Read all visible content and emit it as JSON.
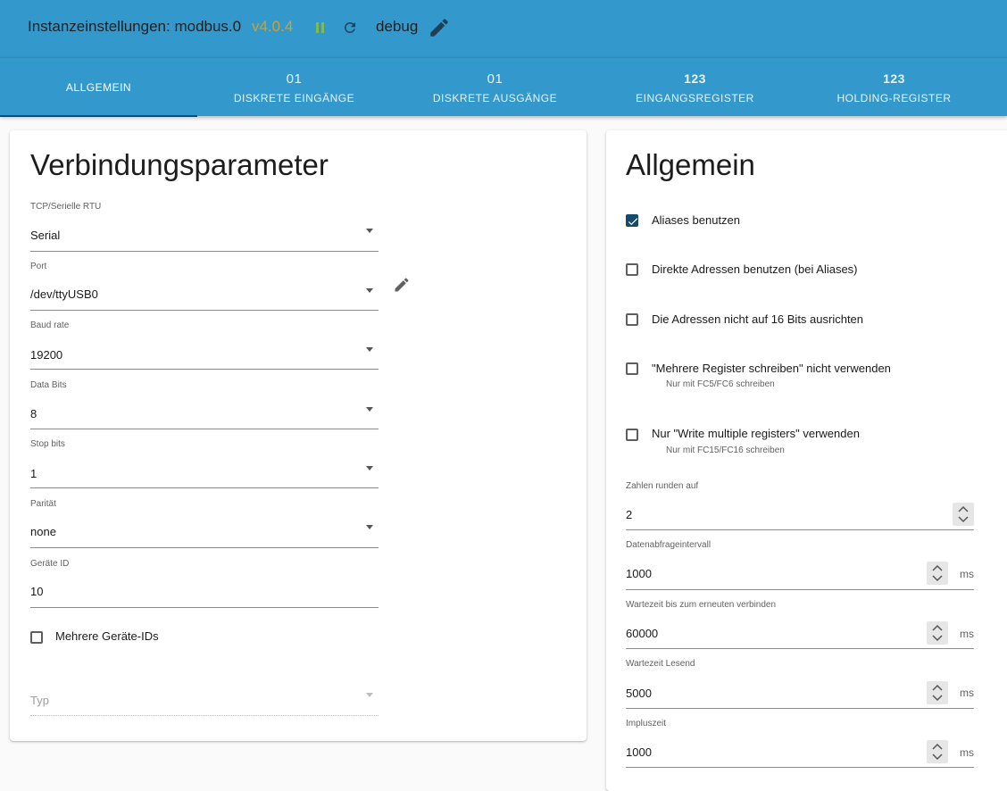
{
  "header": {
    "title": "Instanzeinstellungen: modbus.0",
    "version": "v4.0.4",
    "log_level": "debug",
    "icons": [
      "pause-icon",
      "reload-icon",
      "edit-icon"
    ],
    "colors": {
      "bar": "#3399cc",
      "version": "#c7a23a",
      "running": "#7dbb55"
    }
  },
  "tabs": [
    {
      "icon_text": "",
      "label": "ALLGEMEIN",
      "active": true
    },
    {
      "icon_text": "01",
      "label": "DISKRETE EINGÄNGE"
    },
    {
      "icon_text": "01",
      "label": "DISKRETE AUSGÄNGE"
    },
    {
      "icon_text": "123",
      "label": "EINGANGSREGISTER"
    },
    {
      "icon_text": "123",
      "label": "HOLDING-REGISTER"
    }
  ],
  "connection": {
    "title": "Verbindungsparameter",
    "type": {
      "label": "TCP/Serielle RTU",
      "value": "Serial"
    },
    "port": {
      "label": "Port",
      "value": "/dev/ttyUSB0"
    },
    "baud": {
      "label": "Baud rate",
      "value": "19200"
    },
    "data_bits": {
      "label": "Data Bits",
      "value": "8"
    },
    "stop_bits": {
      "label": "Stop bits",
      "value": "1"
    },
    "parity": {
      "label": "Parität",
      "value": "none"
    },
    "device_id": {
      "label": "Geräte ID",
      "value": "10"
    },
    "multi_device": {
      "label": "Mehrere Geräte-IDs",
      "checked": false
    },
    "typ": {
      "placeholder": "Typ"
    }
  },
  "general": {
    "title": "Allgemein",
    "options": [
      {
        "label": "Aliases benutzen",
        "checked": true,
        "helper": ""
      },
      {
        "label": "Direkte Adressen benutzen (bei Aliases)",
        "checked": false,
        "helper": ""
      },
      {
        "label": "Die Adressen nicht auf 16 Bits ausrichten",
        "checked": false,
        "helper": ""
      },
      {
        "label": "\"Mehrere Register schreiben\" nicht verwenden",
        "checked": false,
        "helper": "Nur mit FC5/FC6 schreiben"
      },
      {
        "label": "Nur \"Write multiple registers\" verwenden",
        "checked": false,
        "helper": "Nur mit FC15/FC16 schreiben"
      }
    ],
    "round": {
      "label": "Zahlen runden auf",
      "value": "2",
      "unit": ""
    },
    "poll": {
      "label": "Datenabfrageintervall",
      "value": "1000",
      "unit": "ms"
    },
    "reconnect": {
      "label": "Wartezeit bis zum erneuten verbinden",
      "value": "60000",
      "unit": "ms"
    },
    "read_timeout": {
      "label": "Wartezeit Lesend",
      "value": "5000",
      "unit": "ms"
    },
    "pulse": {
      "label": "Impluszeit",
      "value": "1000",
      "unit": "ms"
    }
  }
}
